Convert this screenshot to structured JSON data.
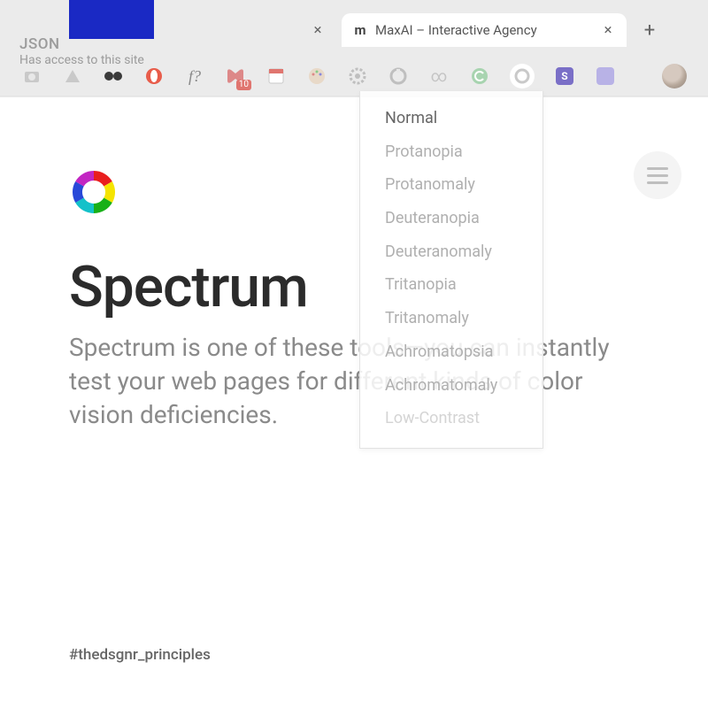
{
  "browser": {
    "tabs": [
      {
        "title": "",
        "active": false
      },
      {
        "title": "MaxAI – Interactive Agency",
        "favicon_letter": "m",
        "active": true
      }
    ],
    "new_tab_glyph": "+",
    "close_glyph": "×"
  },
  "extension_popup": {
    "name": "JSON",
    "access_text": "Has access to this site"
  },
  "ext_toolbar": {
    "icons": [
      "camera-icon",
      "drive-icon",
      "mask-icon",
      "opera-icon",
      "font-icon",
      "meet-icon",
      "calendar-icon",
      "palette-icon",
      "gear-icon",
      "spectrum-ext-icon",
      "loop-icon",
      "grammarly-icon",
      "google-icon",
      "stripe-icon",
      "square-icon"
    ],
    "badge_value": "10",
    "font_label": "f?"
  },
  "dropdown": {
    "items": [
      {
        "label": "Normal",
        "state": "active"
      },
      {
        "label": "Protanopia",
        "state": "normal"
      },
      {
        "label": "Protanomaly",
        "state": "normal"
      },
      {
        "label": "Deuteranopia",
        "state": "normal"
      },
      {
        "label": "Deuteranomaly",
        "state": "normal"
      },
      {
        "label": "Tritanopia",
        "state": "normal"
      },
      {
        "label": "Tritanomaly",
        "state": "normal"
      },
      {
        "label": "Achromatopsia",
        "state": "normal"
      },
      {
        "label": "Achromatomaly",
        "state": "normal"
      },
      {
        "label": "Low-Contrast",
        "state": "faded"
      }
    ]
  },
  "page": {
    "title": "Spectrum",
    "description": "Spectrum is one of these tools—you can instantly test your web pages for different kinds of color vision deficiencies.",
    "hashtag": "#thedsgnr_principles"
  }
}
